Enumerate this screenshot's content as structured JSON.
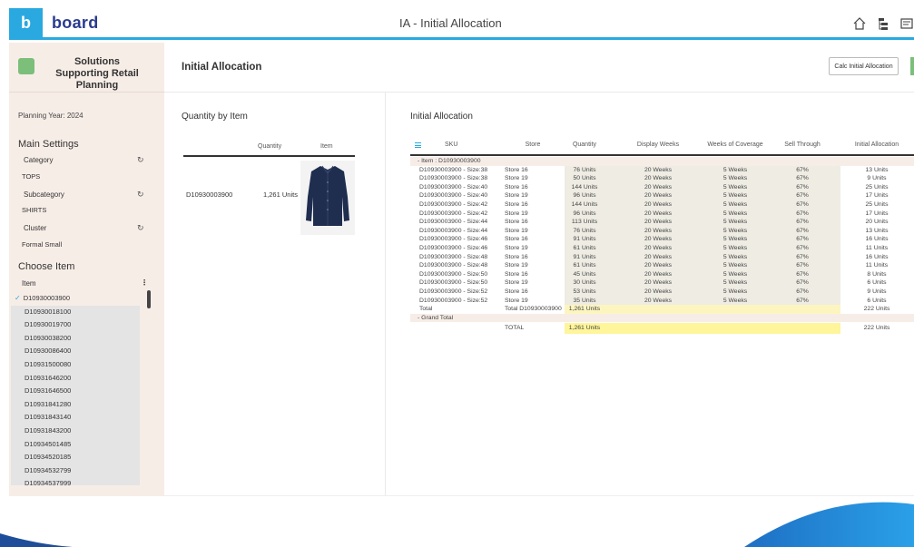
{
  "app": {
    "logo_letter": "b",
    "logo_text": "board",
    "title": "IA - Initial Allocation"
  },
  "sidebar": {
    "brand_title": "Solutions Supporting Retail Planning",
    "planning_year": "Planning Year: 2024",
    "main_settings": "Main Settings",
    "category_label": "Category",
    "category_value": "TOPS",
    "subcategory_label": "Subcategory",
    "subcategory_value": "SHIRTS",
    "cluster_label": "Cluster",
    "cluster_value": "Formal Small",
    "choose_item": "Choose Item",
    "item_label": "Item",
    "items": [
      "D10930003900",
      "D10930018100",
      "D10930019700",
      "D10930038200",
      "D10930086400",
      "D10931500080",
      "D10931646200",
      "D10931646500",
      "D10931841280",
      "D10931843140",
      "D10931843200",
      "D10934501485",
      "D10934520185",
      "D10934532799",
      "D10934537999"
    ]
  },
  "header": {
    "page_title": "Initial Allocation",
    "calc_button": "Calc Initial Allocation"
  },
  "quantity_by_item": {
    "title": "Quantity by Item",
    "col_quantity": "Quantity",
    "col_item": "Item",
    "row": {
      "item": "D10930003900",
      "quantity": "1,261 Units"
    }
  },
  "allocation": {
    "title": "Initial Allocation",
    "columns": [
      "SKU",
      "Store",
      "Quantity",
      "Display Weeks",
      "Weeks of Coverage",
      "Sell Through",
      "Initial Allocation"
    ],
    "group_label": "- Item : D10930003900",
    "rows": [
      [
        "D10930003900 - Size:38",
        "Store 16",
        "76 Units",
        "20 Weeks",
        "5 Weeks",
        "67%",
        "13 Units"
      ],
      [
        "D10930003900 - Size:38",
        "Store 19",
        "50 Units",
        "20 Weeks",
        "5 Weeks",
        "67%",
        "9 Units"
      ],
      [
        "D10930003900 - Size:40",
        "Store 16",
        "144 Units",
        "20 Weeks",
        "5 Weeks",
        "67%",
        "25 Units"
      ],
      [
        "D10930003900 - Size:40",
        "Store 19",
        "96 Units",
        "20 Weeks",
        "5 Weeks",
        "67%",
        "17 Units"
      ],
      [
        "D10930003900 - Size:42",
        "Store 16",
        "144 Units",
        "20 Weeks",
        "5 Weeks",
        "67%",
        "25 Units"
      ],
      [
        "D10930003900 - Size:42",
        "Store 19",
        "96 Units",
        "20 Weeks",
        "5 Weeks",
        "67%",
        "17 Units"
      ],
      [
        "D10930003900 - Size:44",
        "Store 16",
        "113 Units",
        "20 Weeks",
        "5 Weeks",
        "67%",
        "20 Units"
      ],
      [
        "D10930003900 - Size:44",
        "Store 19",
        "76 Units",
        "20 Weeks",
        "5 Weeks",
        "67%",
        "13 Units"
      ],
      [
        "D10930003900 - Size:46",
        "Store 16",
        "91 Units",
        "20 Weeks",
        "5 Weeks",
        "67%",
        "16 Units"
      ],
      [
        "D10930003900 - Size:46",
        "Store 19",
        "61 Units",
        "20 Weeks",
        "5 Weeks",
        "67%",
        "11 Units"
      ],
      [
        "D10930003900 - Size:48",
        "Store 16",
        "91 Units",
        "20 Weeks",
        "5 Weeks",
        "67%",
        "16 Units"
      ],
      [
        "D10930003900 - Size:48",
        "Store 19",
        "61 Units",
        "20 Weeks",
        "5 Weeks",
        "67%",
        "11 Units"
      ],
      [
        "D10930003900 - Size:50",
        "Store 16",
        "45 Units",
        "20 Weeks",
        "5 Weeks",
        "67%",
        "8 Units"
      ],
      [
        "D10930003900 - Size:50",
        "Store 19",
        "30 Units",
        "20 Weeks",
        "5 Weeks",
        "67%",
        "6 Units"
      ],
      [
        "D10930003900 - Size:52",
        "Store 16",
        "53 Units",
        "20 Weeks",
        "5 Weeks",
        "67%",
        "9 Units"
      ],
      [
        "D10930003900 - Size:52",
        "Store 19",
        "35 Units",
        "20 Weeks",
        "5 Weeks",
        "67%",
        "6 Units"
      ]
    ],
    "total": {
      "label": "Total",
      "store": "Total D10930003900",
      "quantity": "1,261 Units",
      "allocation": "222 Units"
    },
    "grand_total_label": "- Grand Total",
    "grand_total": {
      "store": "TOTAL",
      "quantity": "1,261 Units",
      "allocation": "222 Units"
    }
  },
  "colors": {
    "accent": "#29a9e0",
    "brand_text": "#2a3b8f",
    "sidebar_bg": "#f7ede7",
    "green": "#7bbf7a",
    "total_highlight": "#fff59a"
  }
}
